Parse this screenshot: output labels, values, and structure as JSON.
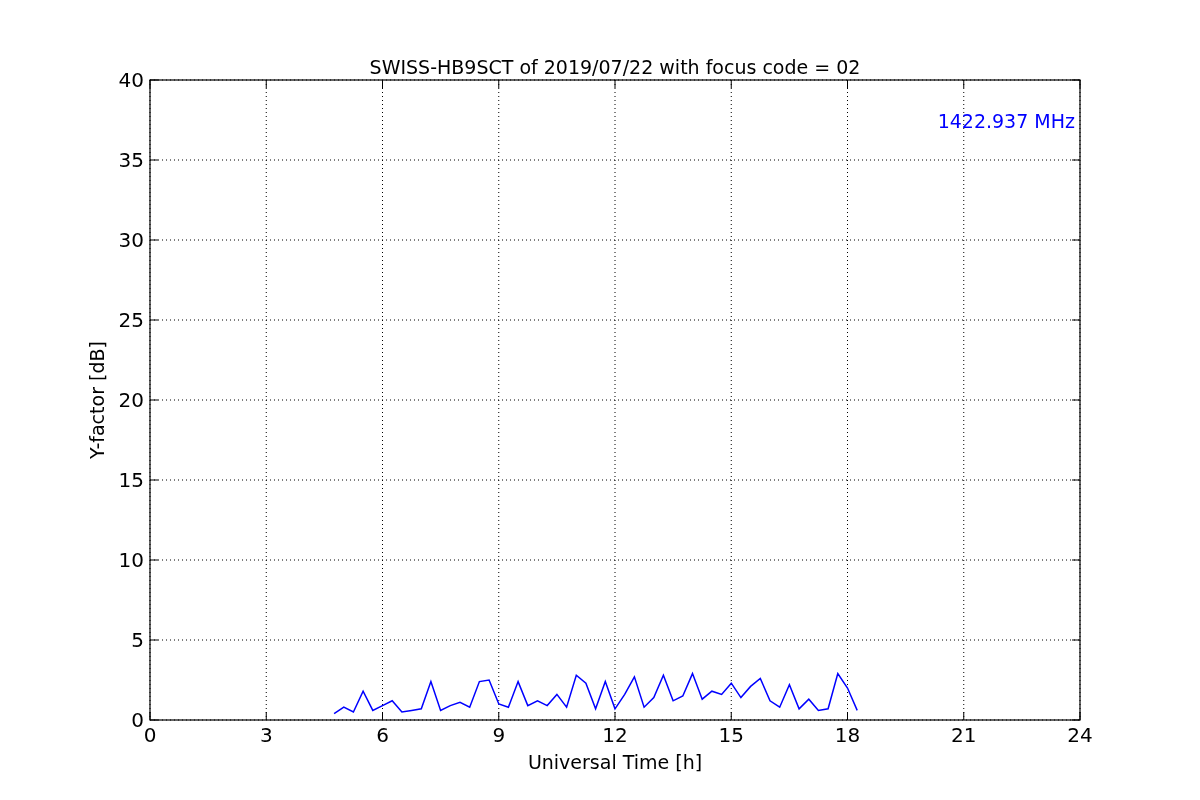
{
  "chart_data": {
    "type": "line",
    "title": "SWISS-HB9SCT of 2019/07/22 with focus code = 02",
    "xlabel": "Universal Time [h]",
    "ylabel": "Y-factor [dB]",
    "xlim": [
      0,
      24
    ],
    "ylim": [
      0,
      40
    ],
    "xticks": [
      0,
      3,
      6,
      9,
      12,
      15,
      18,
      21,
      24
    ],
    "yticks": [
      0,
      5,
      10,
      15,
      20,
      25,
      30,
      35,
      40
    ],
    "grid": true,
    "x": [
      4.75,
      5.0,
      5.25,
      5.5,
      5.75,
      6.0,
      6.25,
      6.5,
      6.75,
      7.0,
      7.25,
      7.5,
      7.75,
      8.0,
      8.25,
      8.5,
      8.75,
      9.0,
      9.25,
      9.5,
      9.75,
      10.0,
      10.25,
      10.5,
      10.75,
      11.0,
      11.25,
      11.5,
      11.75,
      12.0,
      12.25,
      12.5,
      12.75,
      13.0,
      13.25,
      13.5,
      13.75,
      14.0,
      14.25,
      14.5,
      14.75,
      15.0,
      15.25,
      15.5,
      15.75,
      16.0,
      16.25,
      16.5,
      16.75,
      17.0,
      17.25,
      17.5,
      17.75,
      18.0,
      18.25
    ],
    "series": [
      {
        "color": "#0000ff",
        "values": [
          0.4,
          0.8,
          0.5,
          1.8,
          0.6,
          0.9,
          1.2,
          0.5,
          0.6,
          0.7,
          2.4,
          0.6,
          0.9,
          1.1,
          0.8,
          2.4,
          2.5,
          1.0,
          0.8,
          2.4,
          0.9,
          1.2,
          0.9,
          1.6,
          0.8,
          2.8,
          2.3,
          0.7,
          2.4,
          0.7,
          1.6,
          2.7,
          0.8,
          1.4,
          2.8,
          1.2,
          1.5,
          2.9,
          1.3,
          1.8,
          1.6,
          2.3,
          1.4,
          2.1,
          2.6,
          1.2,
          0.8,
          2.2,
          0.7,
          1.3,
          0.6,
          0.7,
          2.9,
          2.0,
          0.6
        ]
      }
    ],
    "annotations": [
      {
        "text": "1422.937 MHz"
      }
    ]
  }
}
